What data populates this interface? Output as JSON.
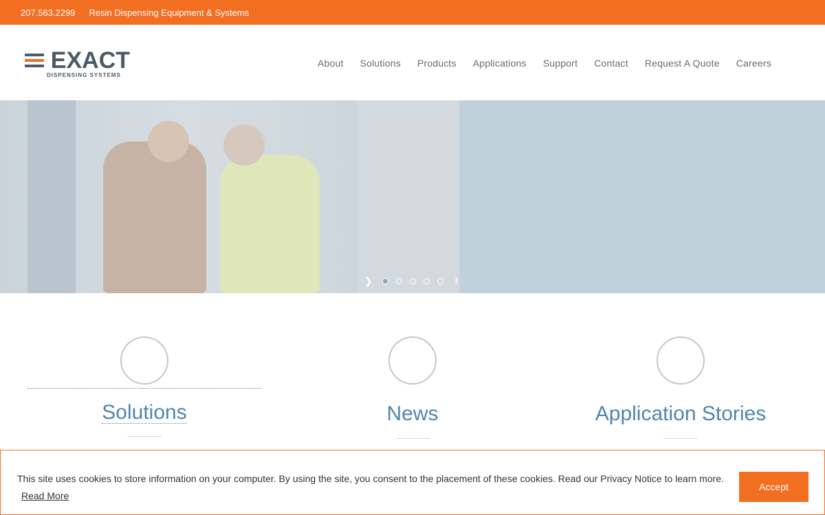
{
  "topbar": {
    "phone": "207.563.2299",
    "tagline": "Resin Dispensing Equipment & Systems"
  },
  "logo": {
    "wordmark": "EXACT",
    "subtitle": "DISPENSING SYSTEMS"
  },
  "nav": {
    "items": [
      "About",
      "Solutions",
      "Products",
      "Applications",
      "Support",
      "Contact",
      "Request A Quote",
      "Careers"
    ]
  },
  "slider": {
    "slide_count": 5,
    "active_index": 0,
    "next_icon": "chevron-right-icon",
    "pause_icon": "pause-icon"
  },
  "features": [
    {
      "title": "Solutions"
    },
    {
      "title": "News"
    },
    {
      "title": "Application Stories"
    }
  ],
  "cookie": {
    "message": "This site uses cookies to store information on your computer. By using the site, you consent to the placement of these cookies. Read our Privacy Notice to learn more.",
    "read_more": "Read More",
    "accept": "Accept"
  },
  "colors": {
    "brand_orange": "#f26f21",
    "link_blue": "#4f86ad",
    "hero_bg": "#c1d1dc"
  }
}
